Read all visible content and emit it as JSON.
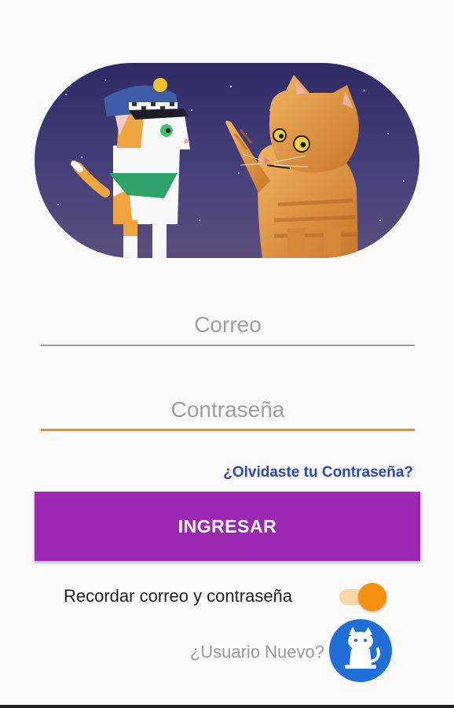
{
  "login": {
    "email_placeholder": "Correo",
    "password_placeholder": "Contraseña",
    "forgot_label": "¿Olvidaste tu Contraseña?",
    "submit_label": "INGRESAR",
    "remember_label": "Recordar correo y contraseña",
    "remember_checked": true,
    "new_user_label": "¿Usuario Nuevo?"
  },
  "icons": {
    "hero": "cats-police-illustration",
    "register": "cat-icon"
  },
  "colors": {
    "accent": "#f5900e",
    "primary_button": "#9c27b0",
    "link": "#2a49b5",
    "fab": "#1f6fd6",
    "hero_sky": "#3e3a74"
  }
}
